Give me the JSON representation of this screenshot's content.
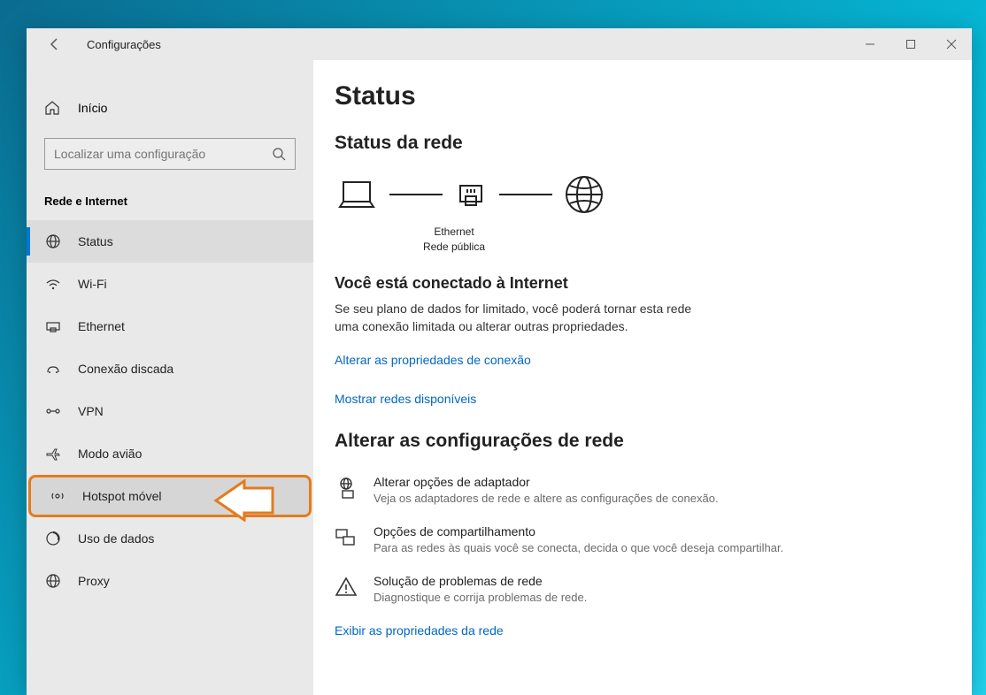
{
  "window": {
    "app_title": "Configurações"
  },
  "sidebar": {
    "home_label": "Início",
    "search_placeholder": "Localizar uma configuração",
    "group_title": "Rede e Internet",
    "items": [
      {
        "label": "Status"
      },
      {
        "label": "Wi-Fi"
      },
      {
        "label": "Ethernet"
      },
      {
        "label": "Conexão discada"
      },
      {
        "label": "VPN"
      },
      {
        "label": "Modo avião"
      },
      {
        "label": "Hotspot móvel"
      },
      {
        "label": "Uso de dados"
      },
      {
        "label": "Proxy"
      }
    ]
  },
  "main": {
    "title": "Status",
    "section_network_title": "Status da rede",
    "network_caption_line1": "Ethernet",
    "network_caption_line2": "Rede pública",
    "connected_title": "Você está conectado à Internet",
    "connected_body": "Se seu plano de dados for limitado, você poderá tornar esta rede uma conexão limitada ou alterar outras propriedades.",
    "link_connection_props": "Alterar as propriedades de conexão",
    "link_show_networks": "Mostrar redes disponíveis",
    "section_change_title": "Alterar as configurações de rede",
    "options": [
      {
        "title": "Alterar opções de adaptador",
        "desc": "Veja os adaptadores de rede e altere as configurações de conexão."
      },
      {
        "title": "Opções de compartilhamento",
        "desc": "Para as redes às quais você se conecta, decida o que você deseja compartilhar."
      },
      {
        "title": "Solução de problemas de rede",
        "desc": "Diagnostique e corrija problemas de rede."
      }
    ],
    "link_network_props": "Exibir as propriedades da rede"
  }
}
